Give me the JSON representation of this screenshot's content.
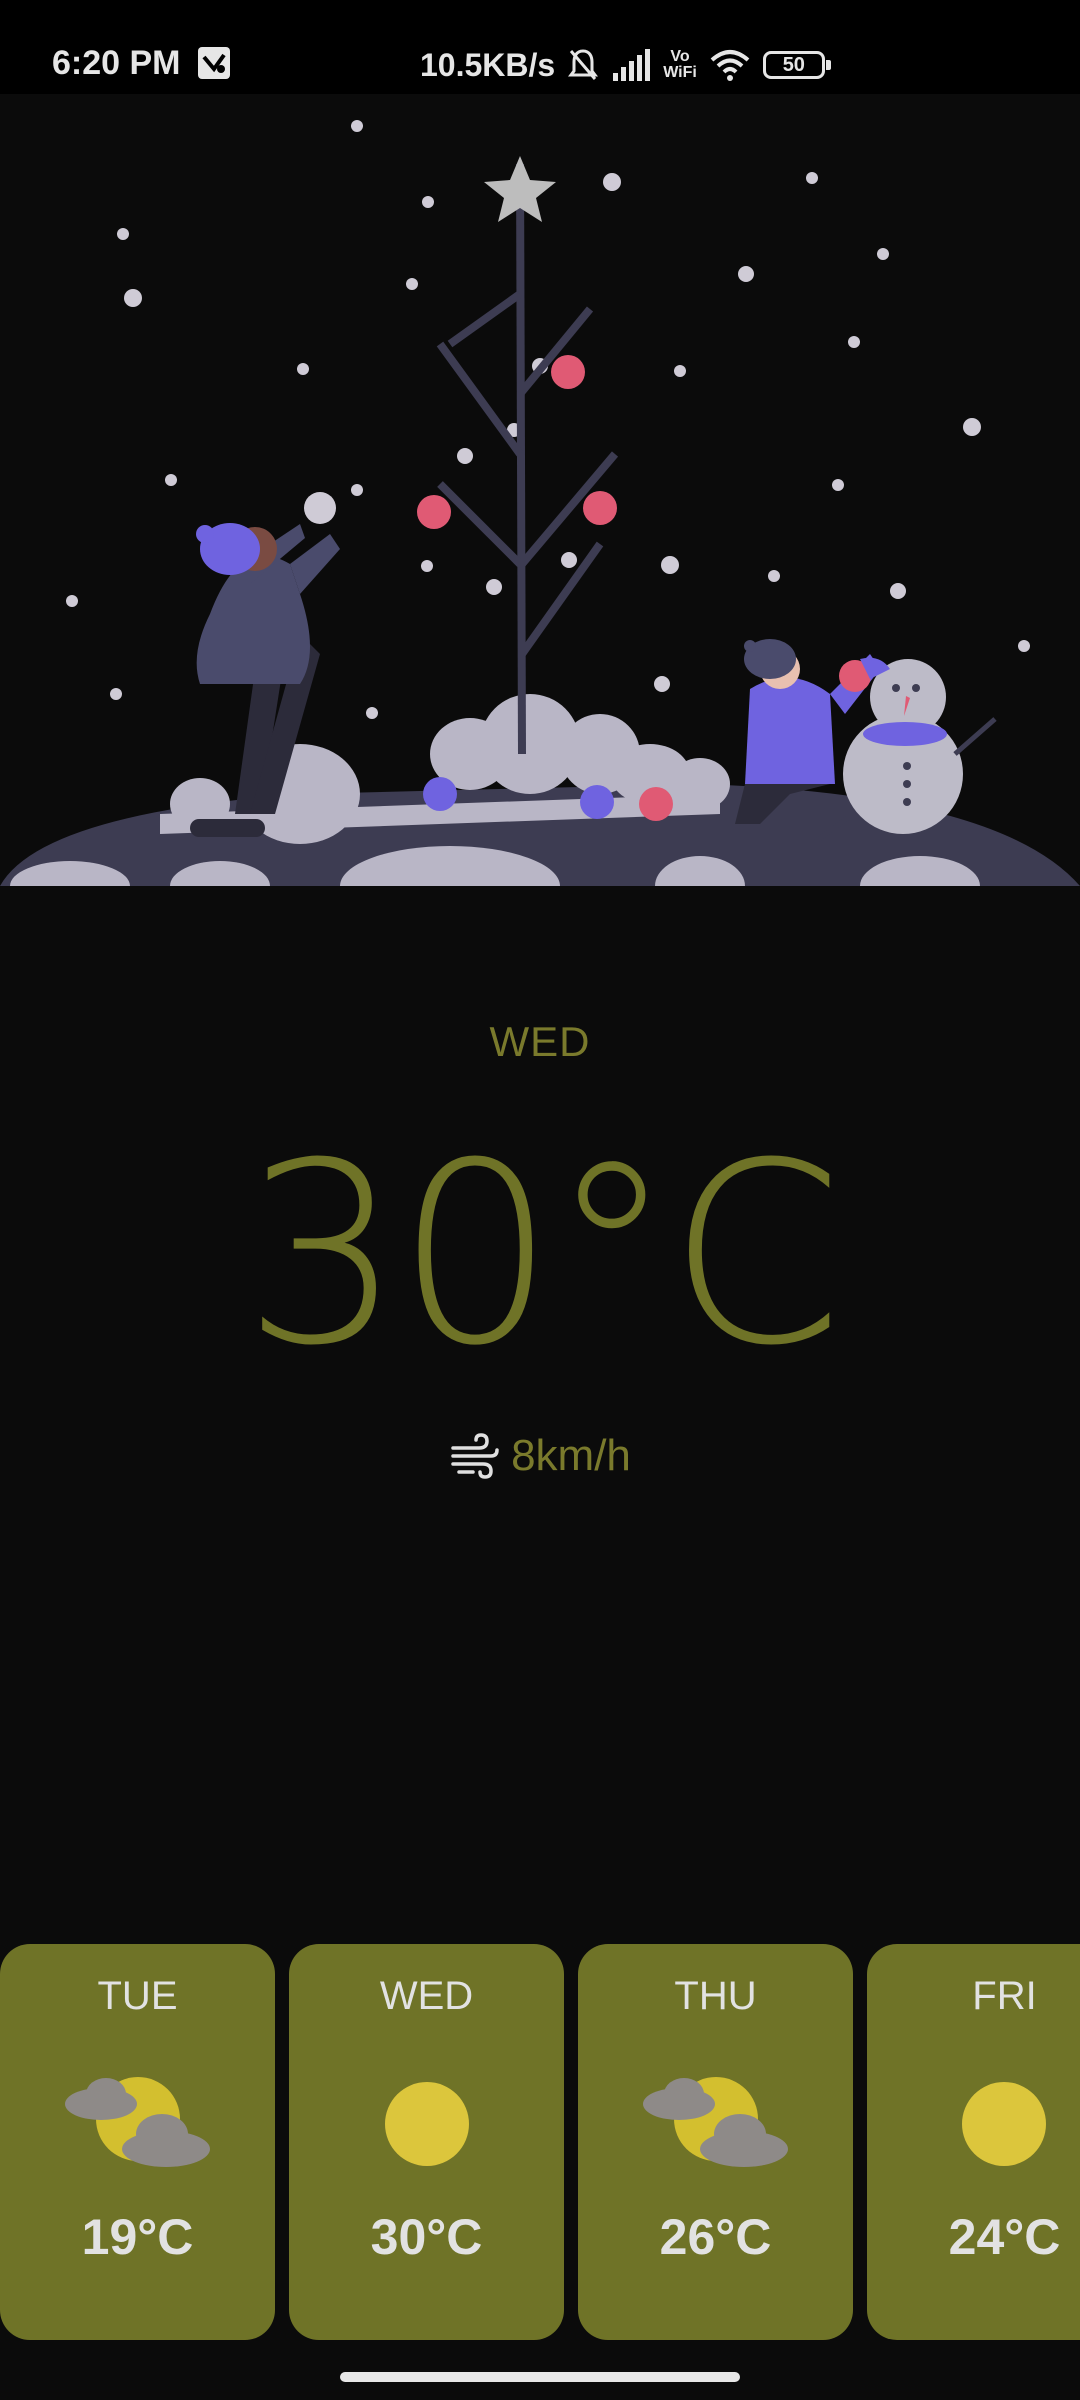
{
  "status_bar": {
    "time": "6:20 PM",
    "speed": "10.5KB/s",
    "volte_top": "Vo",
    "volte_bottom": "WiFi",
    "battery": "50",
    "icons": [
      "gallery-icon",
      "bell-off-icon",
      "signal-icon",
      "vowifi-icon",
      "wifi-icon",
      "battery-icon"
    ]
  },
  "illustration": {
    "icon": "winter-snowman-illustration"
  },
  "current": {
    "day": "WED",
    "temperature": "30°C",
    "wind": "8km/h",
    "wind_icon": "wind-icon"
  },
  "forecast": [
    {
      "day": "TUE",
      "temp": "19°C",
      "icon": "partly-cloudy-icon"
    },
    {
      "day": "WED",
      "temp": "30°C",
      "icon": "sunny-icon"
    },
    {
      "day": "THU",
      "temp": "26°C",
      "icon": "partly-cloudy-icon"
    },
    {
      "day": "FRI",
      "temp": "24°C",
      "icon": "sunny-icon"
    }
  ],
  "colors": {
    "background": "#0b0b0b",
    "accent": "#6f7327",
    "sun": "#dcc63c",
    "cloud": "#8e8a88"
  }
}
